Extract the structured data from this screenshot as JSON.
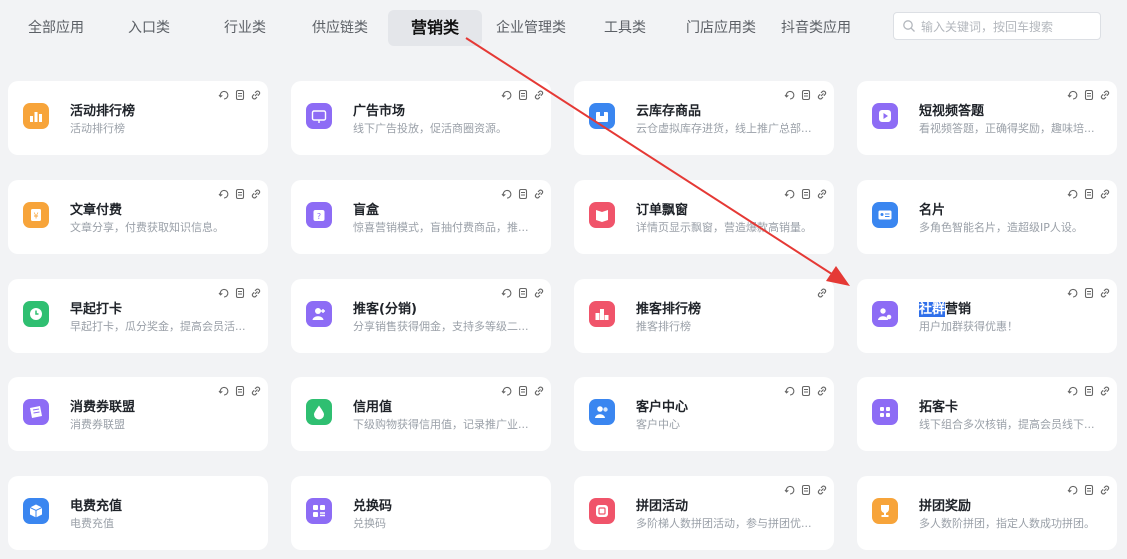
{
  "tabs": [
    {
      "label": "全部应用"
    },
    {
      "label": "入口类"
    },
    {
      "label": "行业类"
    },
    {
      "label": "供应链类"
    },
    {
      "label": "营销类",
      "active": true
    },
    {
      "label": "企业管理类"
    },
    {
      "label": "工具类"
    },
    {
      "label": "门店应用类"
    },
    {
      "label": "抖音类应用"
    }
  ],
  "search": {
    "placeholder": "输入关键词，按回车搜索"
  },
  "cards": [
    {
      "title": "活动排行榜",
      "desc": "活动排行榜",
      "icon": "bar-chart-icon",
      "color": "#f7a43a"
    },
    {
      "title": "广告市场",
      "desc": "线下广告投放，促活商圈资源。",
      "icon": "ad-icon",
      "color": "#8d6cf5"
    },
    {
      "title": "云库存商品",
      "desc": "云仓虚拟库存进货，线上推广总部...",
      "icon": "box-icon",
      "color": "#3a86f0"
    },
    {
      "title": "短视频答题",
      "desc": "看视频答题，正确得奖励，趣味培...",
      "icon": "video-icon",
      "color": "#8d6cf5"
    },
    {
      "title": "文章付费",
      "desc": "文章分享，付费获取知识信息。",
      "icon": "yen-doc-icon",
      "color": "#f7a43a"
    },
    {
      "title": "盲盒",
      "desc": "惊喜营销模式，盲抽付费商品，推...",
      "icon": "gift-box-icon",
      "color": "#8d6cf5"
    },
    {
      "title": "订单飘窗",
      "desc": "详情页显示飘窗，营造爆款高销量。",
      "icon": "book-icon",
      "color": "#f0546a"
    },
    {
      "title": "名片",
      "desc": "多角色智能名片，造超级IP人设。",
      "icon": "card-icon",
      "color": "#3a86f0"
    },
    {
      "title": "早起打卡",
      "desc": "早起打卡，瓜分奖金，提高会员活...",
      "icon": "clock-icon",
      "color": "#2fbf71"
    },
    {
      "title": "推客(分销)",
      "desc": "分享销售获得佣金，支持多等级二...",
      "icon": "user-plus-icon",
      "color": "#8d6cf5"
    },
    {
      "title": "推客排行榜",
      "desc": "推客排行榜",
      "icon": "podium-icon",
      "color": "#f0546a"
    },
    {
      "title": "社群营销",
      "desc": "用户加群获得优惠！",
      "icon": "group-icon",
      "color": "#8d6cf5",
      "highlight": "社群",
      "rest": "营销"
    },
    {
      "title": "消费券联盟",
      "desc": "消费券联盟",
      "icon": "ticket-icon",
      "color": "#8d6cf5"
    },
    {
      "title": "信用值",
      "desc": "下级购物获得信用值，记录推广业...",
      "icon": "drop-icon",
      "color": "#2fbf71"
    },
    {
      "title": "客户中心",
      "desc": "客户中心",
      "icon": "users-icon",
      "color": "#3a86f0"
    },
    {
      "title": "拓客卡",
      "desc": "线下组合多次核销，提高会员线下...",
      "icon": "grid-icon",
      "color": "#8d6cf5"
    },
    {
      "title": "电费充值",
      "desc": "电费充值",
      "icon": "cube-icon",
      "color": "#3a86f0"
    },
    {
      "title": "兑换码",
      "desc": "兑换码",
      "icon": "code-icon",
      "color": "#8d6cf5"
    },
    {
      "title": "拼团活动",
      "desc": "多阶梯人数拼团活动，参与拼团优...",
      "icon": "group-buy-icon",
      "color": "#f0546a"
    },
    {
      "title": "拼团奖励",
      "desc": "多人数阶拼团，指定人数成功拼团。",
      "icon": "trophy-icon",
      "color": "#f7a43a"
    }
  ]
}
